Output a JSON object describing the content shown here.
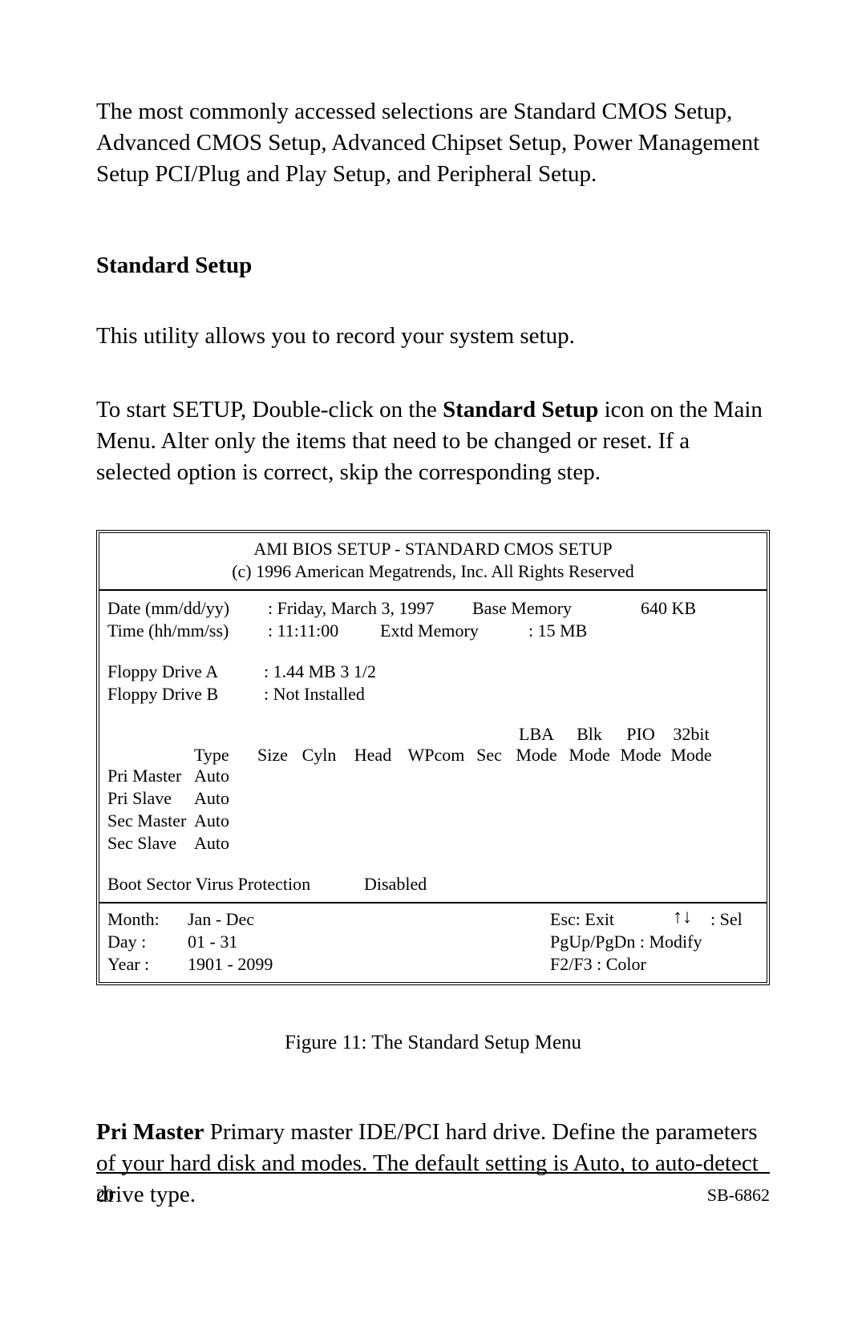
{
  "intro": "The most commonly accessed selections are Standard CMOS Setup, Advanced CMOS Setup, Advanced Chipset Setup, Power Management Setup PCI/Plug and Play Setup, and Peripheral Setup.",
  "heading": "Standard Setup",
  "para1": "This utility allows you to record your system setup.",
  "para2_a": "To start SETUP, Double-click on the ",
  "para2_bold": "Standard Setup",
  "para2_b": " icon on the Main Menu. Alter only the items that need to be changed or reset. If a selected option is correct, skip the corresponding step.",
  "bios": {
    "title": "AMI BIOS SETUP - STANDARD CMOS SETUP",
    "copyright": "(c) 1996 American Megatrends, Inc. All Rights Reserved",
    "date_label": "Date (mm/dd/yy)",
    "date_value": ": Friday, March 3, 1997",
    "basemem_label": "Base Memory",
    "basemem_value": "640 KB",
    "time_label": "Time (hh/mm/ss)",
    "time_value": ": 11:11:00",
    "extmem_label": "Extd Memory",
    "extmem_value": ": 15 MB",
    "floppy_a_label": "Floppy Drive A",
    "floppy_a_value": ": 1.44 MB 3 1/2",
    "floppy_b_label": "Floppy Drive B",
    "floppy_b_value": ": Not Installed",
    "hdr": {
      "type": "Type",
      "size": "Size",
      "cyln": "Cyln",
      "head": "Head",
      "wpcom": "WPcom",
      "sec": "Sec",
      "lba": "LBA",
      "blk": "Blk",
      "pio": "PIO",
      "bit32": "32bit",
      "mode": "Mode"
    },
    "drives": [
      {
        "name": "Pri Master",
        "type": "Auto"
      },
      {
        "name": "Pri Slave",
        "type": "Auto"
      },
      {
        "name": "Sec Master",
        "type": "Auto"
      },
      {
        "name": "Sec Slave",
        "type": "Auto"
      }
    ],
    "boot_label": "Boot Sector Virus Protection",
    "boot_value": "Disabled",
    "footer": {
      "month_label": "Month:",
      "month_value": "Jan - Dec",
      "day_label": "Day :",
      "day_value": "01 - 31",
      "year_label": "Year :",
      "year_value": "1901 - 2099",
      "esc": "Esc: Exit",
      "pgupdn": "PgUp/PgDn : Modify",
      "f2f3": "F2/F3 : Color",
      "sel": ": Sel"
    }
  },
  "fig_caption": "Figure 11: The Standard Setup Menu",
  "pri_master_bold": "Pri Master",
  "pri_master_text": "  Primary master IDE/PCI hard drive. Define the parameters of your hard disk and modes. The default setting is Auto, to auto-detect drive type.",
  "page_num": "20",
  "doc_code": "SB-6862"
}
